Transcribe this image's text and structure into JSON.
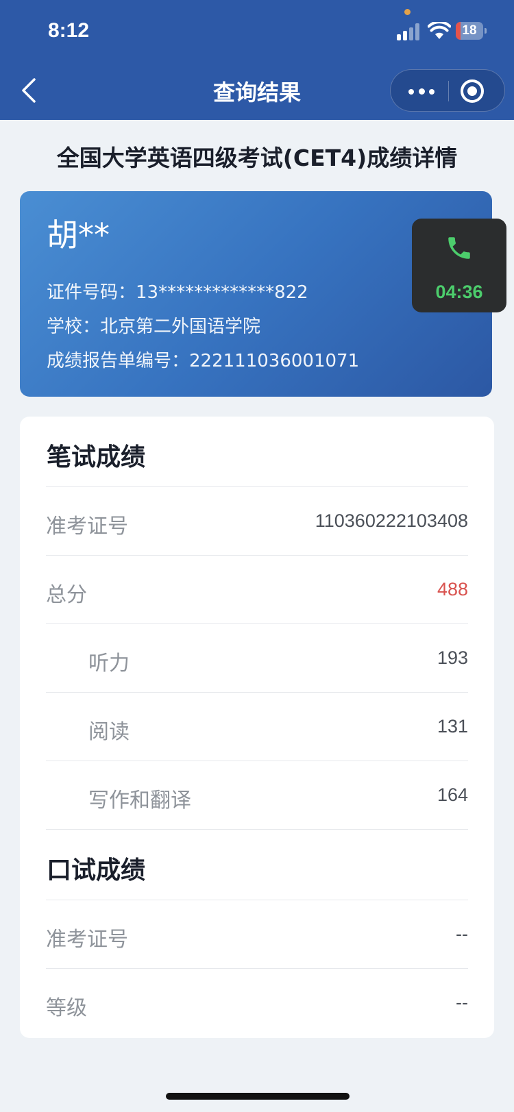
{
  "status_bar": {
    "time": "8:12",
    "battery_level": "18",
    "battery_fraction": 0.18,
    "icons": [
      "signal-icon",
      "wifi-icon",
      "battery-icon"
    ]
  },
  "nav": {
    "title": "查询结果",
    "back_icon": "chevron-left-icon",
    "more_icon": "more-dots-icon",
    "close_icon": "target-circle-icon"
  },
  "page": {
    "heading": "全国大学英语四级考试(CET4)成绩详情"
  },
  "candidate": {
    "name": "胡**",
    "id_line": "证件号码：13*************822",
    "school_line": "学校：北京第二外国语学院",
    "report_line": "成绩报告单编号：222111036001071"
  },
  "call_widget": {
    "icon": "phone-icon",
    "timer": "04:36",
    "accent_color": "#4ccd6c"
  },
  "written": {
    "title": "笔试成绩",
    "rows": [
      {
        "label": "准考证号",
        "value": "110360222103408"
      },
      {
        "label": "总分",
        "value": "488"
      },
      {
        "label": "听力",
        "value": "193"
      },
      {
        "label": "阅读",
        "value": "131"
      },
      {
        "label": "写作和翻译",
        "value": "164"
      }
    ]
  },
  "oral": {
    "title": "口试成绩",
    "rows": [
      {
        "label": "准考证号",
        "value": "--"
      },
      {
        "label": "等级",
        "value": "--"
      }
    ]
  },
  "colors": {
    "header_blue": "#2d59a7",
    "total_score_red": "#d9534f"
  }
}
